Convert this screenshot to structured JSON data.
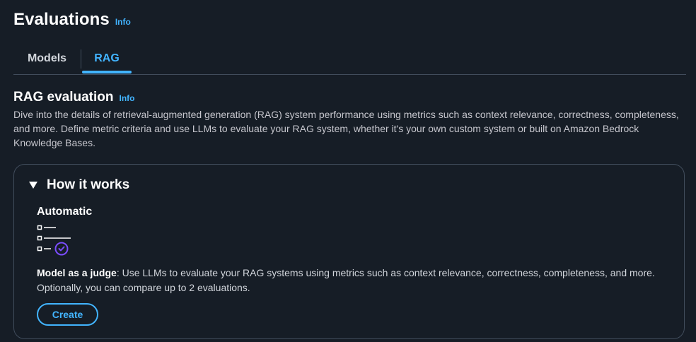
{
  "header": {
    "title": "Evaluations",
    "info_label": "Info"
  },
  "tabs": [
    {
      "label": "Models",
      "selected": false
    },
    {
      "label": "RAG",
      "selected": true
    }
  ],
  "section": {
    "title": "RAG evaluation",
    "info_label": "Info",
    "description": "Dive into the details of retrieval-augmented generation (RAG) system performance using metrics such as context relevance, correctness, completeness, and more. Define metric criteria and use LLMs to evaluate your RAG system, whether it's your own custom system or built on Amazon Bedrock Knowledge Bases."
  },
  "how_it_works": {
    "title": "How it works",
    "expanded": true,
    "option": {
      "title": "Automatic",
      "icon": "checklist-icon",
      "desc_bold": "Model as a judge",
      "desc_rest": ": Use LLMs to evaluate your RAG systems using metrics such as context relevance, correctness, completeness, and more. Optionally, you can compare up to 2 evaluations.",
      "button_label": "Create"
    }
  },
  "colors": {
    "background": "#161d26",
    "accent": "#42b4ff",
    "border": "#414d5c",
    "icon_check": "#7b4dff"
  }
}
